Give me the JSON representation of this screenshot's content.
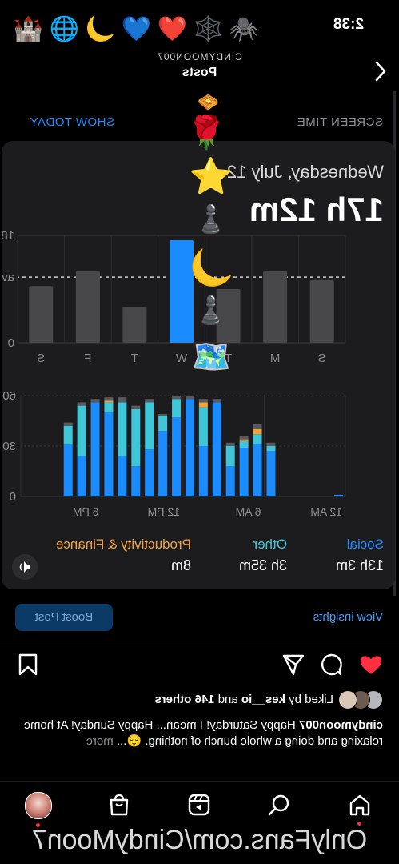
{
  "status_bar": {
    "time": "2:38"
  },
  "header": {
    "username": "CINDYMOON007",
    "title": "Posts"
  },
  "bio_emojis": [
    "🏰",
    "🌐",
    "🌙",
    "💙",
    "❤️",
    "🕸️",
    "🕷️"
  ],
  "screen_time": {
    "title": "SCREEN TIME",
    "show_today": "SHOW TODAY",
    "date": "Wednesday, July 12",
    "total": "17h 12m",
    "weekly": {
      "ticks": [
        "18h",
        "avg",
        "0"
      ],
      "days": [
        "S",
        "M",
        "T",
        "W",
        "T",
        "F",
        "S"
      ],
      "values": [
        10.5,
        12.0,
        9.0,
        17.2,
        6.0,
        12.0,
        9.5
      ],
      "avg": 11.0
    },
    "hourly": {
      "ticks": [
        "60m",
        "30m",
        "0"
      ],
      "hour_labels": [
        "12 AM",
        "6 AM",
        "12 PM",
        "6 PM"
      ],
      "social": [
        1,
        0,
        0,
        0,
        0,
        27,
        31,
        29,
        18,
        56,
        30,
        58,
        47,
        39,
        28,
        18,
        24,
        50,
        56,
        24,
        31,
        0,
        0,
        0
      ],
      "other": [
        0,
        0,
        0,
        0,
        0,
        3,
        6,
        4,
        12,
        0,
        23,
        0,
        11,
        9,
        28,
        34,
        32,
        6,
        0,
        30,
        11,
        0,
        0,
        0
      ],
      "productivity": [
        0,
        0,
        0,
        0,
        0,
        0,
        3,
        1,
        0,
        0,
        3,
        0,
        0,
        0,
        0,
        0,
        0,
        1,
        0,
        0,
        0,
        0,
        0,
        0
      ],
      "gray": [
        0,
        0,
        0,
        0,
        0,
        2,
        3,
        2,
        2,
        2,
        2,
        2,
        2,
        1,
        2,
        2,
        3,
        2,
        2,
        2,
        2,
        0,
        0,
        0
      ],
      "colors": {
        "social": "#1a8cff",
        "other": "#3fc6d8",
        "productivity": "#f2a23c",
        "gray": "#5a5a5e"
      }
    },
    "categories": [
      {
        "name": "Social",
        "value": "13h 3m",
        "color": "#1a8cff"
      },
      {
        "name": "Other",
        "value": "3h 35m",
        "color": "#3fc6d8"
      },
      {
        "name": "Productivity & Finance",
        "value": "8m",
        "color": "#f2a23c"
      }
    ]
  },
  "overlay_emojis": [
    "🧇",
    "🌹",
    "⭐",
    "♟️",
    "🌙",
    "♟️",
    "🗺️"
  ],
  "post_actions": {
    "view_insights": "View insights",
    "boost_post": "Boost Post"
  },
  "likes": {
    "prefix": "Liked by",
    "user": "kes__io",
    "middle": "and",
    "others": "146 others"
  },
  "caption": {
    "username": "cindymoon007",
    "text": "Happy Saturday! I mean... Happy Sunday! At home relaxing and doing a whole bunch of nothing. 😌...",
    "more": "more"
  },
  "watermark": "OnlyFans.com/CindyMoon7"
}
